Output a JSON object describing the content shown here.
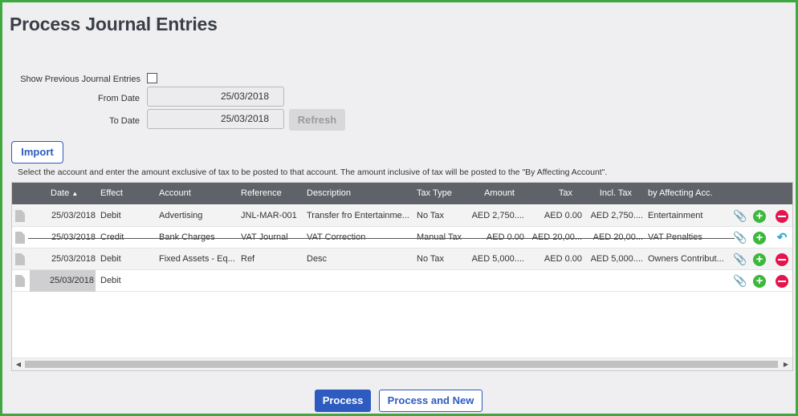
{
  "page": {
    "title": "Process Journal Entries"
  },
  "filters": {
    "show_previous_label": "Show Previous Journal Entries",
    "show_previous_checked": false,
    "from_label": "From Date",
    "from_value": "25/03/2018",
    "to_label": "To Date",
    "to_value": "25/03/2018",
    "refresh_label": "Refresh"
  },
  "import_label": "Import",
  "hint": "Select the account and enter the amount exclusive of tax to be posted to that account. The amount inclusive of tax will be posted to the \"By Affecting Account\".",
  "grid": {
    "columns": {
      "date": "Date",
      "date_sort_icon": "sort-ascending-icon",
      "effect": "Effect",
      "account": "Account",
      "reference": "Reference",
      "description": "Description",
      "tax_type": "Tax Type",
      "amount": "Amount",
      "tax": "Tax",
      "incl_tax": "Incl. Tax",
      "by_affecting": "by Affecting Acc."
    },
    "rows": [
      {
        "date": "25/03/2018",
        "effect": "Debit",
        "account": "Advertising",
        "reference": "JNL-MAR-001",
        "description": "Transfer fro Entertainme...",
        "tax_type": "No Tax",
        "amount": "AED 2,750....",
        "tax": "AED 0.00",
        "incl_tax": "AED 2,750....",
        "by_affecting": "Entertainment"
      },
      {
        "date": "25/03/2018",
        "effect": "Credit",
        "account": "Bank Charges",
        "reference": "VAT Journal",
        "description": "VAT Correction",
        "tax_type": "Manual Tax",
        "amount": "AED 0.00",
        "tax": "AED 20,00...",
        "incl_tax": "AED 20,00...",
        "by_affecting": "VAT Penalties"
      },
      {
        "date": "25/03/2018",
        "effect": "Debit",
        "account": "Fixed Assets - Eq...",
        "reference": "Ref",
        "description": "Desc",
        "tax_type": "No Tax",
        "amount": "AED 5,000....",
        "tax": "AED 0.00",
        "incl_tax": "AED 5,000....",
        "by_affecting": "Owners Contribut..."
      },
      {
        "date": "25/03/2018",
        "effect": "Debit"
      }
    ]
  },
  "actions": {
    "process": "Process",
    "process_new": "Process and New"
  },
  "colors": {
    "frame": "#3fa83f",
    "primary": "#2d5bbf",
    "header": "#5f6268",
    "add": "#3cb83c",
    "remove": "#e4144c",
    "undo": "#2b9fd8"
  },
  "icons": [
    "document-icon",
    "paperclip-icon",
    "add-row-icon",
    "remove-row-icon",
    "undo-icon"
  ]
}
